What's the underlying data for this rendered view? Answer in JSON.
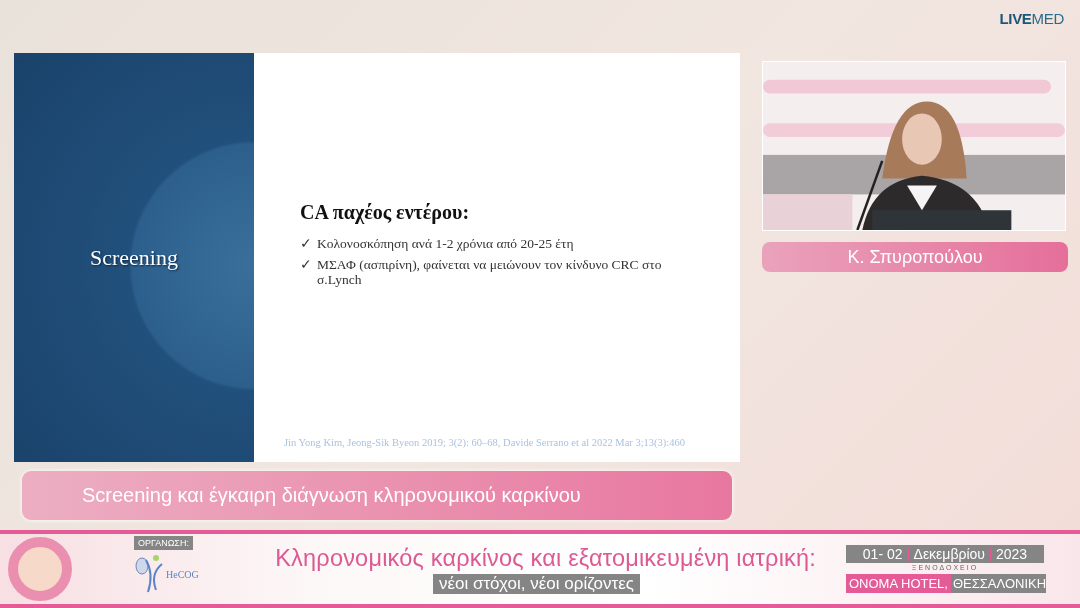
{
  "brand": {
    "bold": "LIVE",
    "rest": "MED"
  },
  "slide": {
    "section_title": "Screening",
    "heading": "CA παχέος εντέρου:",
    "bullets": [
      {
        "mark": "✓",
        "text": "Κολονοσκόπηση ανά 1-2 χρόνια από 20-25 έτη"
      },
      {
        "mark": "✓",
        "text": "ΜΣΑΦ (ασπιρίνη), φαίνεται να μειώνουν τον κίνδυνο CRC στο σ.Lynch"
      }
    ],
    "citation": "Jin Yong Kim, Jeong-Sik Byeon 2019; 3(2): 60–68, Davide Serrano et al  2022 Mar 3;13(3):460"
  },
  "speaker": {
    "name": "Κ. Σπυροπούλου"
  },
  "talk_title": "Screening και έγκαιρη διάγνωση κληρονομικού καρκίνου",
  "banner": {
    "organizer_label": "ΟΡΓΑΝΩΣΗ:",
    "organizer_logo": "HeCOG",
    "title": "Κληρονομικός καρκίνος και εξατομικευμένη ιατρική:",
    "subtitle": "νέοι στόχοι, νέοι ορίζοντες",
    "date": [
      "01- 02",
      "Δεκεμβρίου",
      "2023"
    ],
    "venue_label": "ΞΕΝΟΔΟΧΕΙΟ",
    "venue": "ΟΝΟΜΑ HOTEL,",
    "city": "ΘΕΣΣΑΛΟΝΙΚΗ"
  }
}
